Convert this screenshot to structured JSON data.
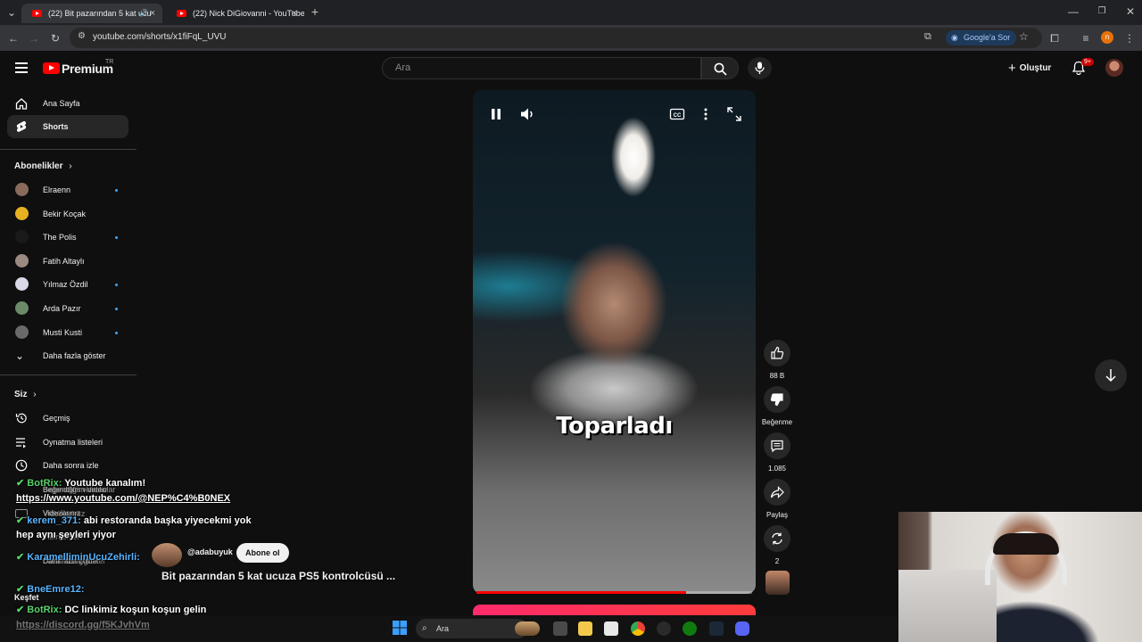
{
  "browser": {
    "tabs": [
      {
        "label": "(22) Bit pazarından 5 kat ucu",
        "active": true
      },
      {
        "label": "(22) Nick DiGiovanni - YouTube",
        "active": false
      }
    ],
    "new_tab": "+",
    "url": "youtube.com/shorts/x1fiFqL_UVU",
    "google_ask": "Google'a Sor",
    "profile_initial": "n"
  },
  "header": {
    "logo": "Premium",
    "region": "TR",
    "search_placeholder": "Ara",
    "create_label": "Oluştur",
    "notifications": "9+"
  },
  "sidebar": {
    "main": [
      {
        "label": "Ana Sayfa",
        "icon": "home-icon"
      },
      {
        "label": "Shorts",
        "icon": "shorts-icon",
        "active": true
      }
    ],
    "subscriptions_title": "Abonelikler",
    "subscriptions": [
      {
        "name": "Elraenn",
        "dot": true,
        "color": "#8a6a5a"
      },
      {
        "name": "Bekir Koçak",
        "dot": false,
        "color": "#e8b020"
      },
      {
        "name": "The Polis",
        "dot": true,
        "color": "#1a1a1a"
      },
      {
        "name": "Fatih Altaylı",
        "dot": false,
        "color": "#9a8a82"
      },
      {
        "name": "Yılmaz Özdil",
        "dot": true,
        "color": "#d8d8e8"
      },
      {
        "name": "Arda Pazır",
        "dot": true,
        "color": "#6a8a6a"
      },
      {
        "name": "Musti Kusti",
        "dot": true,
        "color": "#6a6a6a"
      }
    ],
    "show_more": "Daha fazla göster",
    "you_title": "Siz",
    "you": [
      {
        "label": "Geçmiş",
        "icon": "history-icon"
      },
      {
        "label": "Oynatma listeleri",
        "icon": "playlist-icon"
      },
      {
        "label": "Daha sonra izle",
        "icon": "clock-icon"
      },
      {
        "label": "Beğendiğim videolar",
        "icon": "like-icon"
      },
      {
        "label": "Videolarınız",
        "icon": "video-icon"
      },
      {
        "label": "İndirilenler",
        "icon": "download-icon"
      },
      {
        "label": "Daha fazla göster",
        "icon": "chevron-down-icon"
      }
    ],
    "explore": "Keşfet"
  },
  "video": {
    "caption": "Toparladı",
    "title": "Bit pazarından 5 kat ucuza PS5 kontrolcüsü ...",
    "channel_handle": "@adabuyuk",
    "subscribe_label": "Abone ol",
    "progress": 0.76
  },
  "actions": {
    "likes": "88 B",
    "dislike_label": "Beğenme",
    "comments": "1.085",
    "share_label": "Paylaş",
    "remix_count": "2"
  },
  "chat": [
    {
      "user": "BotRix:",
      "text": " Youtube kanalım!",
      "user_class": "u"
    },
    {
      "user": "",
      "text": "https://www.youtube.com/@NEP%C4%B0NEX",
      "link": true
    },
    {
      "user": "kerem_371:",
      "text": " abi restoranda başka yiyecekmi yok",
      "user_class": "u2"
    },
    {
      "user": "",
      "text": "hep aynı şeyleri yiyor"
    },
    {
      "user": "KaramelliminUcuZehirli:",
      "text": "",
      "user_class": "u2"
    },
    {
      "user": "BneEmre12:",
      "text": "",
      "user_class": "u2"
    },
    {
      "user": "BotRix:",
      "text": " DC linkimiz koşun koşun gelin",
      "user_class": "u"
    },
    {
      "user": "",
      "text": "https://discord.gg/f5KJvhVm",
      "link": true
    }
  ],
  "taskbar": {
    "search_label": "Ara"
  }
}
